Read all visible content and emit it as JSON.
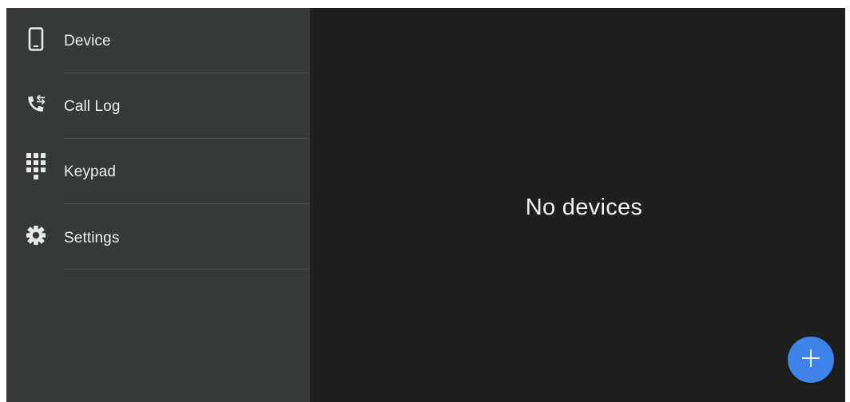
{
  "sidebar": {
    "items": [
      {
        "label": "Device",
        "icon": "phone-device-icon"
      },
      {
        "label": "Call Log",
        "icon": "call-log-icon"
      },
      {
        "label": "Keypad",
        "icon": "keypad-icon"
      },
      {
        "label": "Settings",
        "icon": "gear-icon"
      }
    ]
  },
  "main": {
    "empty_text": "No devices"
  },
  "fab": {
    "icon": "plus-icon"
  },
  "colors": {
    "sidebar_bg": "#35393a",
    "main_bg": "#1f1f1f",
    "accent": "#3d83ea",
    "text": "#eeeeee"
  }
}
